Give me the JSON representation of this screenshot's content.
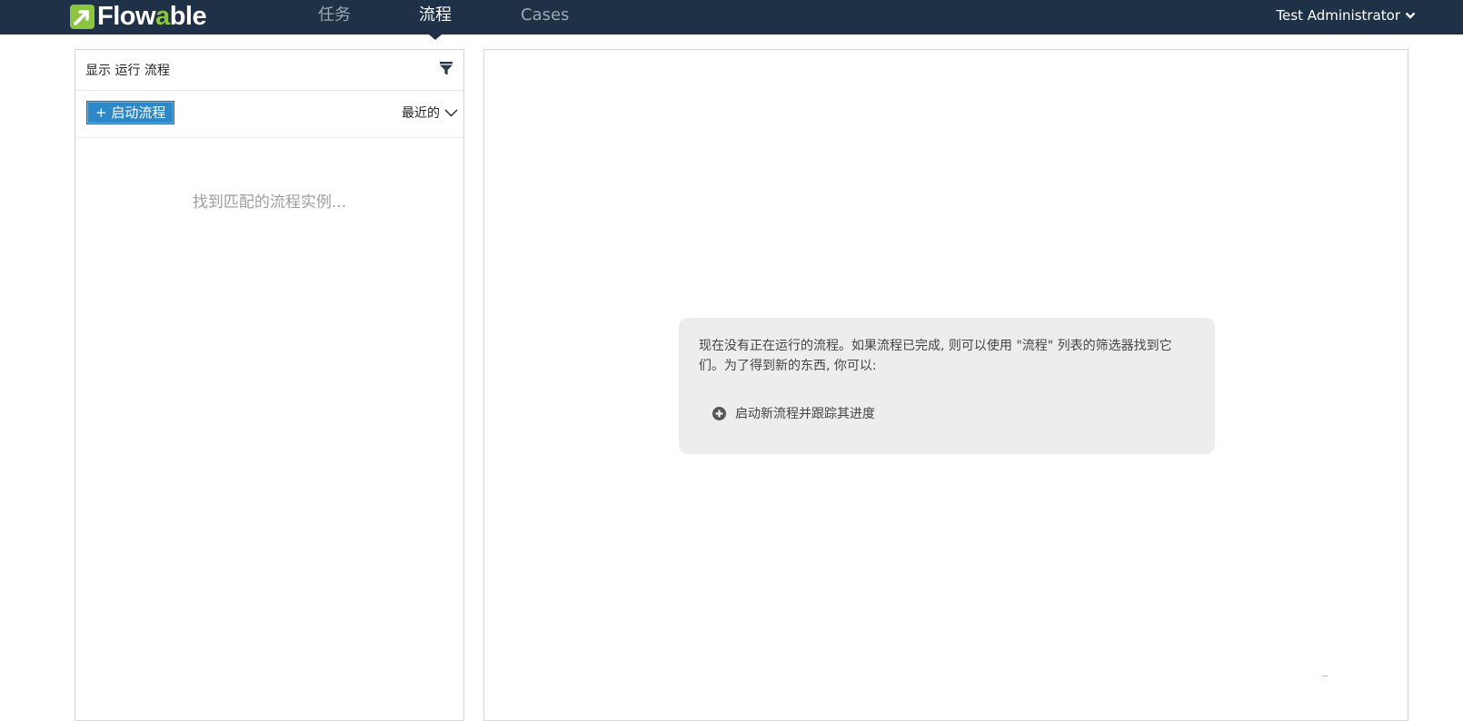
{
  "app": {
    "logo_prefix": "Flow",
    "logo_accent": "a",
    "logo_suffix": "ble",
    "brand_color": "#8cc63f",
    "nav_bg": "#1f3146"
  },
  "nav": {
    "tabs": [
      {
        "label": "任务",
        "active": false
      },
      {
        "label": "流程",
        "active": true
      },
      {
        "label": "Cases",
        "active": false
      }
    ],
    "user": "Test Administrator"
  },
  "left": {
    "title": "显示 运行 流程",
    "start_button": "+ 启动流程",
    "sort_label": "最近的",
    "empty_message": "找到匹配的流程实例..."
  },
  "right": {
    "help_text": "现在没有正在运行的流程。如果流程已完成, 则可以使用 \"流程\" 列表的筛选器找到它们。为了得到新的东西, 你可以:",
    "action_label": "启动新流程并跟踪其进度"
  },
  "icons": {
    "logo": "flowable-logo-icon",
    "filter": "filter-icon",
    "user_chevron": "chevron-down-icon",
    "sort_chevron": "chevron-down-icon",
    "action": "plus-circle-icon"
  }
}
